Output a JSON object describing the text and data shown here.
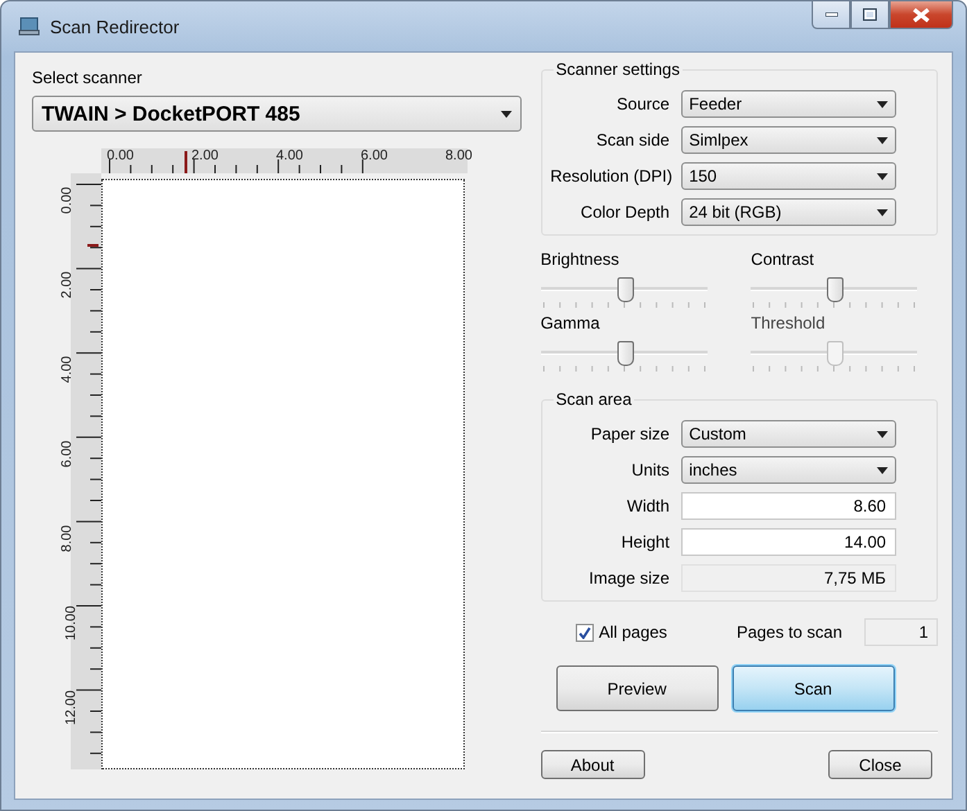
{
  "window": {
    "title": "Scan Redirector"
  },
  "scanner": {
    "label": "Select scanner",
    "value": "TWAIN > DocketPORT 485"
  },
  "preview": {
    "top_ruler": [
      "0.00",
      "2.00",
      "4.00",
      "6.00",
      "8.00"
    ],
    "side_ruler": [
      "0.00",
      "2.00",
      "4.00",
      "6.00",
      "8.00",
      "10.00",
      "12.00"
    ]
  },
  "scanner_settings": {
    "title": "Scanner settings",
    "fields": [
      {
        "label": "Source",
        "value": "Feeder"
      },
      {
        "label": "Scan side",
        "value": "Simlpex"
      },
      {
        "label": "Resolution (DPI)",
        "value": "150"
      },
      {
        "label": "Color Depth",
        "value": "24 bit (RGB)"
      }
    ]
  },
  "sliders": [
    {
      "label": "Brightness",
      "level": 0.5,
      "disabled": false
    },
    {
      "label": "Contrast",
      "level": 0.5,
      "disabled": false
    },
    {
      "label": "Gamma",
      "level": 0.5,
      "disabled": false
    },
    {
      "label": "Threshold",
      "level": 0.5,
      "disabled": true
    }
  ],
  "scan_area": {
    "title": "Scan area",
    "fields": [
      {
        "label": "Paper size",
        "kind": "dropdown",
        "value": "Custom"
      },
      {
        "label": "Units",
        "kind": "dropdown",
        "value": "inches"
      },
      {
        "label": "Width",
        "kind": "input",
        "value": "8.60"
      },
      {
        "label": "Height",
        "kind": "input",
        "value": "14.00"
      },
      {
        "label": "Image size",
        "kind": "readonly",
        "value": "7,75 МБ"
      }
    ]
  },
  "all_pages": {
    "label": "All pages",
    "checked": true
  },
  "pages_to_scan": {
    "label": "Pages to scan",
    "value": "1"
  },
  "buttons": [
    {
      "label": "Preview",
      "default": false
    },
    {
      "label": "Scan",
      "default": true
    }
  ],
  "footer_buttons": [
    "About",
    "Close"
  ]
}
